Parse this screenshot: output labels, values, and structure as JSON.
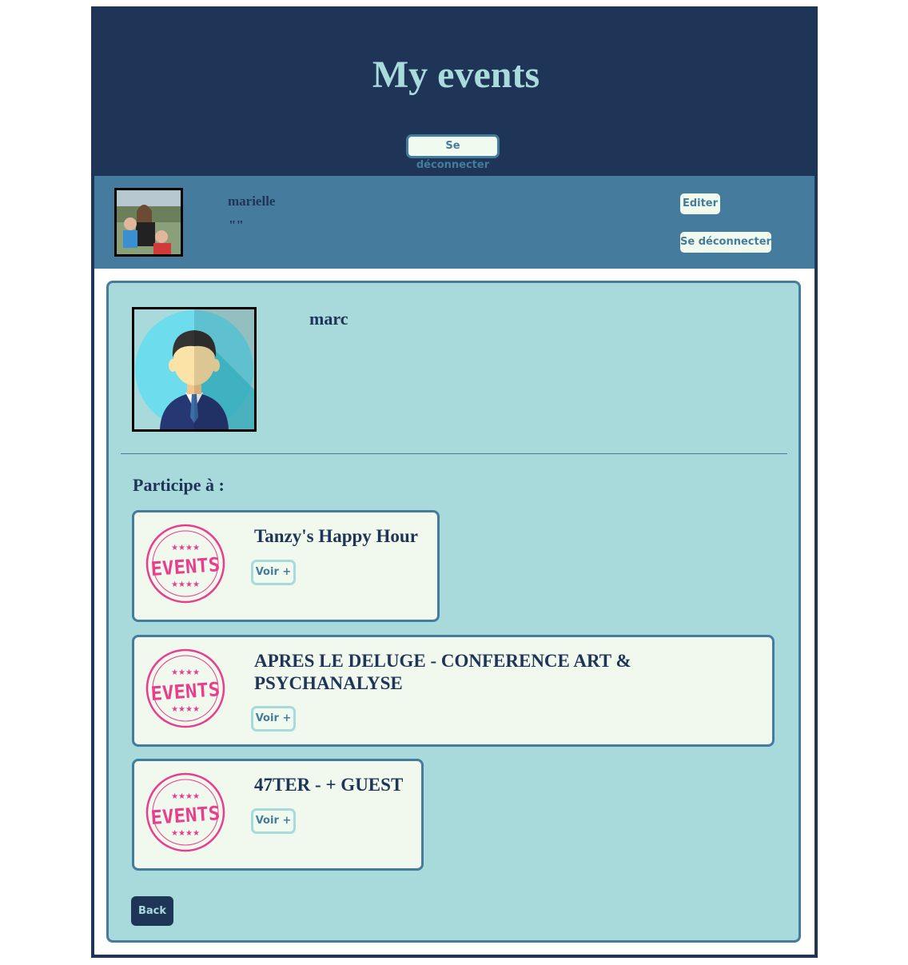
{
  "header": {
    "title": "My events",
    "logout_label": "Se déconnecter"
  },
  "user": {
    "name": "marielle",
    "quote": "\"\"",
    "edit_label": "Editer",
    "logout_label": "Se déconnecter"
  },
  "profile": {
    "name": "marc",
    "participates_label": "Participe à :"
  },
  "events": [
    {
      "title": "Tanzy's Happy Hour",
      "button_label": "Voir +",
      "logo_text": "EVENTS",
      "logo_stars": "★★★★"
    },
    {
      "title": "APRES LE DELUGE - CONFERENCE ART & PSYCHANALYSE",
      "button_label": "Voir +",
      "logo_text": "EVENTS",
      "logo_stars": "★★★★"
    },
    {
      "title": "47TER - + GUEST",
      "button_label": "Voir +",
      "logo_text": "EVENTS",
      "logo_stars": "★★★★"
    }
  ],
  "back_label": "Back",
  "colors": {
    "navy": "#1f3557",
    "steel_blue": "#457b9d",
    "light_teal": "#a8dadc",
    "off_white": "#f1faee",
    "pink": "#e83e8c"
  }
}
